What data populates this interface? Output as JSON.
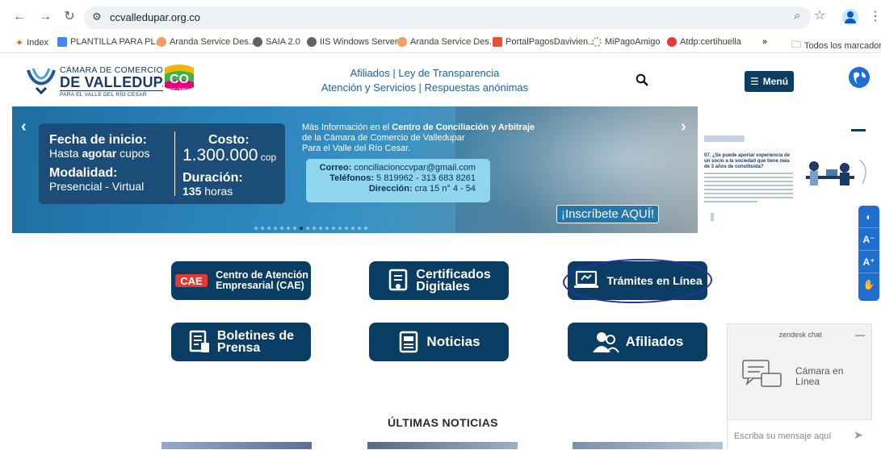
{
  "browser": {
    "url": "ccvalledupar.org.co",
    "bookmarks": [
      "Index",
      "PLANTILLA PARA PL...",
      "Aranda Service Des...",
      "SAIA 2.0",
      "IIS Windows Server",
      "Aranda Service Des...",
      "PortalPagosDavivien...",
      "MiPagoAmigo",
      "Atdp:certihuella",
      "»",
      "Todos los marcadores"
    ]
  },
  "header": {
    "logo_line1": "CÁMARA DE COMERCIO",
    "logo_line2": "DE VALLEDUPAR",
    "logo_line3": "PARA EL VALLE DEL RÍO CESAR",
    "co_logo_text": "CO",
    "co_logo_sub": "COLOMBIA",
    "link_afiliados": "Afiliados",
    "link_transparencia": "Ley de Transparencia",
    "link_atencion": "Atención y Servicios",
    "link_respuestas": "Respuestas anónimas",
    "separator": "|",
    "menu_label": "Menú"
  },
  "banner": {
    "fecha_label": "Fecha de inicio:",
    "fecha_pre": "Hasta ",
    "fecha_bold": "agotar",
    "fecha_post": " cupos",
    "modalidad_label": "Modalidad:",
    "modalidad_value": "Presencial - Virtual",
    "costo_label": "Costo:",
    "costo_value": "1.300.000",
    "costo_unit": " cop",
    "duracion_label": "Duración:",
    "duracion_value": "135",
    "duracion_unit": " horas",
    "info_pre": "Más Información en el ",
    "info_bold": "Centro de Conciliación y Arbitraje",
    "info_line2": "de la Cámara de Comercio de Valledupar",
    "info_line3": "Para el Valle del Río Cesar.",
    "correo_label": "Correo:",
    "correo_value": " conciliacionccvpar@gmail.com",
    "telefonos_label": "Teléfonos:",
    "telefonos_value": " 5 819962 - 313 683 8261",
    "direccion_label": "Dirección:",
    "direccion_value": " cra 15 n° 4 - 54",
    "cta": "¡Inscríbete AQUÍ!"
  },
  "side_preview": {
    "title": "07. ¿Se puede aportar experiencia de un socio a la sociedad que tiene más de 3 años de constituida?"
  },
  "a11y": [
    "◐",
    "A⁻",
    "A⁺",
    "✋"
  ],
  "services": {
    "cae_l1": "Centro de Atención",
    "cae_l2": "Empresarial (CAE)",
    "cae_logo": "CAE",
    "cert_l1": "Certificados",
    "cert_l2": "Digitales",
    "tramites": "Trámites en Línea",
    "boletines_l1": "Boletines de",
    "boletines_l2": "Prensa",
    "noticias": "Noticias",
    "afiliados": "Afiliados"
  },
  "news": {
    "title": "ÚLTIMAS NOTICIAS"
  },
  "chat": {
    "header": "zendesk chat",
    "status_l1": "Cámara en",
    "status_l2": "Línea",
    "placeholder": "Escriba su mensaje aquí"
  }
}
